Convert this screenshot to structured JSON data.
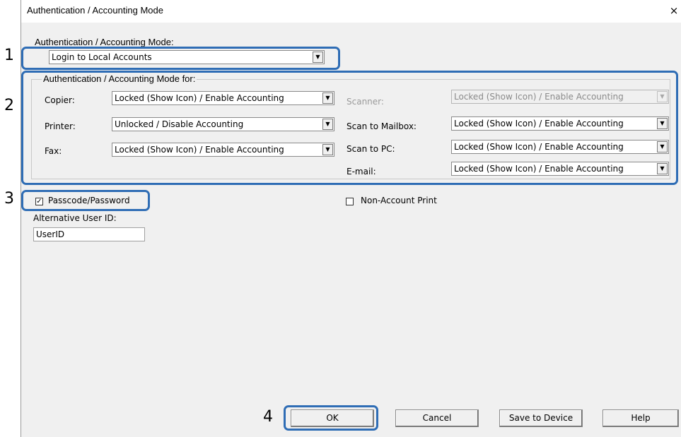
{
  "window": {
    "title": "Authentication / Accounting Mode",
    "close_symbol": "×"
  },
  "mode": {
    "label": "Authentication / Accounting Mode:",
    "value": "Login to Local Accounts"
  },
  "group": {
    "legend": "Authentication / Accounting Mode for:",
    "copier": {
      "label": "Copier:",
      "value": "Locked (Show Icon) / Enable Accounting"
    },
    "printer": {
      "label": "Printer:",
      "value": "Unlocked / Disable Accounting"
    },
    "fax": {
      "label": "Fax:",
      "value": "Locked (Show Icon) / Enable Accounting"
    },
    "scanner": {
      "label": "Scanner:",
      "value": "Locked (Show Icon) / Enable Accounting",
      "disabled": true
    },
    "scan_to_mailbox": {
      "label": "Scan to Mailbox:",
      "value": "Locked (Show Icon) / Enable Accounting"
    },
    "scan_to_pc": {
      "label": "Scan to PC:",
      "value": "Locked (Show Icon) / Enable Accounting"
    },
    "email": {
      "label": "E-mail:",
      "value": "Locked (Show Icon) / Enable Accounting"
    }
  },
  "passcode": {
    "label": "Passcode/Password",
    "checked": true,
    "mark": "✓"
  },
  "non_account_print": {
    "label": "Non-Account Print",
    "checked": false
  },
  "alt_user_id": {
    "label": "Alternative User ID:",
    "value": "UserID"
  },
  "buttons": {
    "ok": "OK",
    "cancel": "Cancel",
    "save": "Save to Device",
    "help": "Help"
  },
  "callouts": [
    "1",
    "2",
    "3",
    "4"
  ],
  "colors": {
    "highlight": "#2f6db5",
    "dialog_bg": "#f0f0f0"
  }
}
